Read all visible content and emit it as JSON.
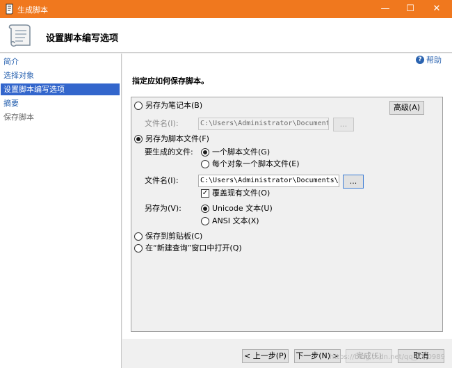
{
  "window": {
    "title": "生成脚本",
    "minimize_glyph": "—",
    "maximize_glyph": "☐",
    "close_glyph": "✕",
    "accent_color": "#f0781e"
  },
  "header": {
    "title": "设置脚本编写选项"
  },
  "sidebar": {
    "items": [
      {
        "label": "简介",
        "state": "normal"
      },
      {
        "label": "选择对象",
        "state": "normal"
      },
      {
        "label": "设置脚本编写选项",
        "state": "selected"
      },
      {
        "label": "摘要",
        "state": "normal"
      },
      {
        "label": "保存脚本",
        "state": "disabled"
      }
    ]
  },
  "main": {
    "help_label": "帮助",
    "section_label": "指定应如何保存脚本。",
    "advanced_button": "高级(A)",
    "save_to_notebook": {
      "label": "另存为笔记本(B)",
      "checked": false,
      "filename_label": "文件名(I):",
      "filename_value": "C:\\Users\\Administrator\\Documents\\scr",
      "browse_label": "..."
    },
    "save_to_file": {
      "label": "另存为脚本文件(F)",
      "checked": true,
      "generate_label": "要生成的文件:",
      "single_file": "一个脚本文件(G)",
      "per_object": "每个对象一个脚本文件(E)",
      "filename_label": "文件名(I):",
      "filename_value": "C:\\Users\\Administrator\\Documents\\scr",
      "browse_label": "...",
      "overwrite_label": "覆盖现有文件(O)",
      "overwrite_checked": true,
      "save_as_label": "另存为(V):",
      "unicode_label": "Unicode 文本(U)",
      "ansi_label": "ANSI 文本(X)"
    },
    "save_to_clipboard": {
      "label": "保存到剪贴板(C)",
      "checked": false
    },
    "open_in_query": {
      "label": "在“新建查询”窗口中打开(Q)",
      "checked": false
    }
  },
  "footer": {
    "previous": "< 上一步(P)",
    "next": "下一步(N) >",
    "finish": "完成(F)",
    "cancel": "取消",
    "watermark": "https://blog.csdn.net/qq_41.0989"
  }
}
